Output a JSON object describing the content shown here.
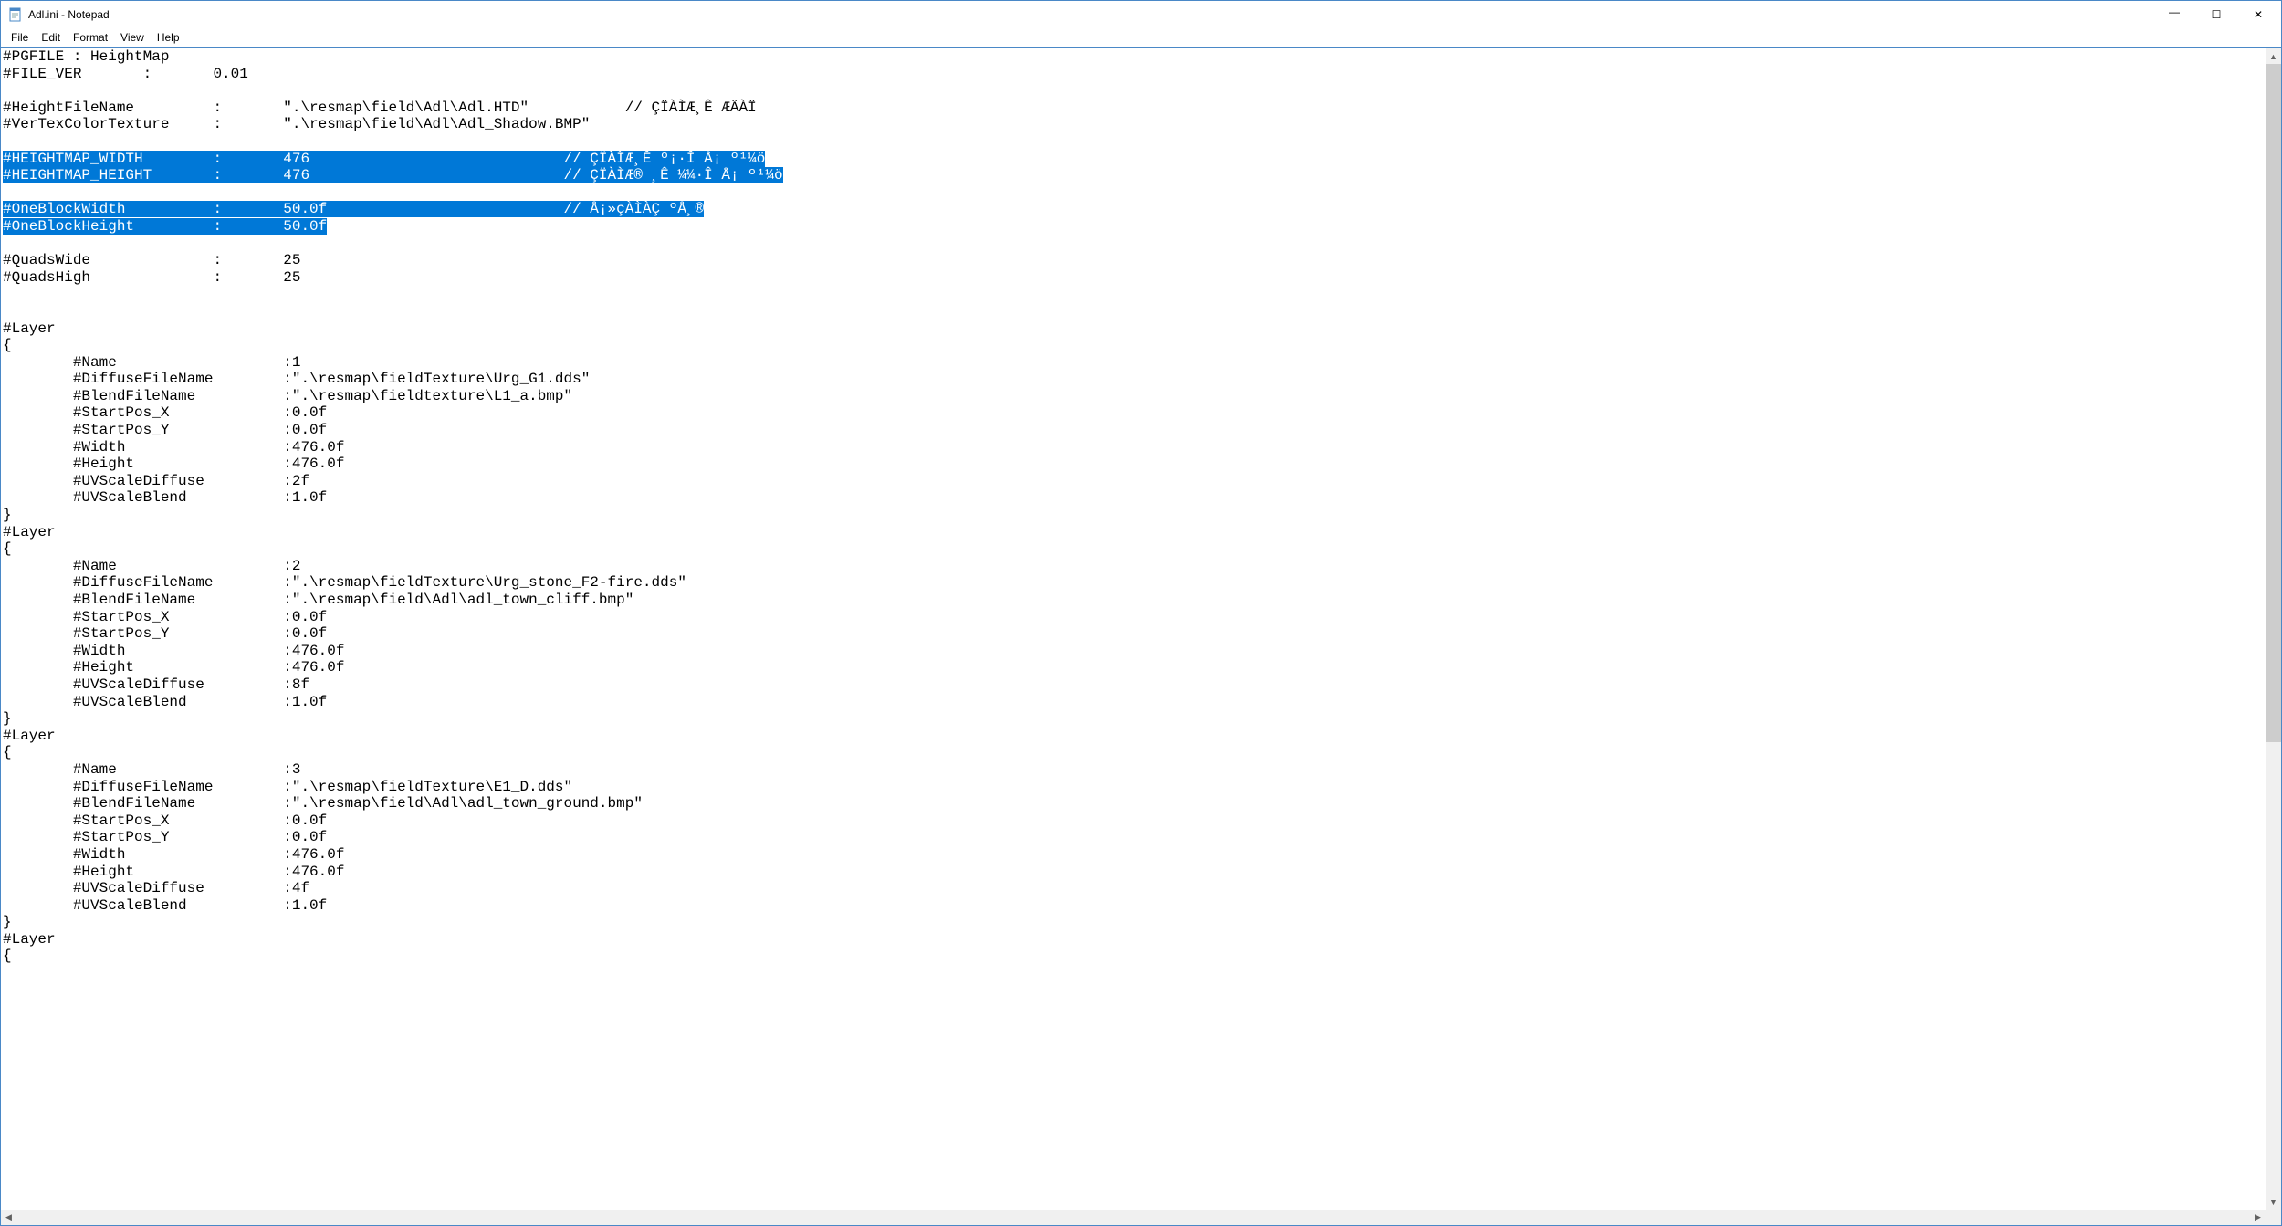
{
  "window": {
    "title": "Adl.ini - Notepad"
  },
  "menu": {
    "file": "File",
    "edit": "Edit",
    "format": "Format",
    "view": "View",
    "help": "Help"
  },
  "glyphs": {
    "min": "—",
    "max": "☐",
    "close": "✕",
    "up": "▲",
    "down": "▼",
    "left": "◀",
    "right": "▶"
  },
  "doc": {
    "pre1": "#PGFILE : HeightMap\n#FILE_VER       :       0.01\n\n#HeightFileName         :       \".\\resmap\\field\\Adl\\Adl.HTD\"           // ÇÏÀÌÆ¸Ê ÆÄÀÏ\n#VerTexColorTexture     :       \".\\resmap\\field\\Adl\\Adl_Shadow.BMP\"\n\n",
    "sel1": "#HEIGHTMAP_WIDTH        :       476                             // ÇÏÀÌÆ¸Ê º¡·Î Å¡ º¹¼ö\n#HEIGHTMAP_HEIGHT       :       476                             // ÇÏÀÌÆ® ¸Ê ¼¼·Î Å¡ º¹¼ö",
    "mid1": "\n\n",
    "sel2": "#OneBlockWidth          :       50.0f                           // Å¡»çÀÌÀÇ ºÅ¸®\n#OneBlockHeight         :       50.0f",
    "post1": "\n\n#QuadsWide              :       25\n#QuadsHigh              :       25\n\n\n#Layer\n{\n        #Name                   :1\n        #DiffuseFileName        :\".\\resmap\\fieldTexture\\Urg_G1.dds\"\n        #BlendFileName          :\".\\resmap\\fieldtexture\\L1_a.bmp\"\n        #StartPos_X             :0.0f\n        #StartPos_Y             :0.0f\n        #Width                  :476.0f\n        #Height                 :476.0f\n        #UVScaleDiffuse         :2f\n        #UVScaleBlend           :1.0f\n}\n#Layer\n{\n        #Name                   :2\n        #DiffuseFileName        :\".\\resmap\\fieldTexture\\Urg_stone_F2-fire.dds\"\n        #BlendFileName          :\".\\resmap\\field\\Adl\\adl_town_cliff.bmp\"\n        #StartPos_X             :0.0f\n        #StartPos_Y             :0.0f\n        #Width                  :476.0f\n        #Height                 :476.0f\n        #UVScaleDiffuse         :8f\n        #UVScaleBlend           :1.0f\n}\n#Layer\n{\n        #Name                   :3\n        #DiffuseFileName        :\".\\resmap\\fieldTexture\\E1_D.dds\"\n        #BlendFileName          :\".\\resmap\\field\\Adl\\adl_town_ground.bmp\"\n        #StartPos_X             :0.0f\n        #StartPos_Y             :0.0f\n        #Width                  :476.0f\n        #Height                 :476.0f\n        #UVScaleDiffuse         :4f\n        #UVScaleBlend           :1.0f\n}\n#Layer\n{"
  }
}
